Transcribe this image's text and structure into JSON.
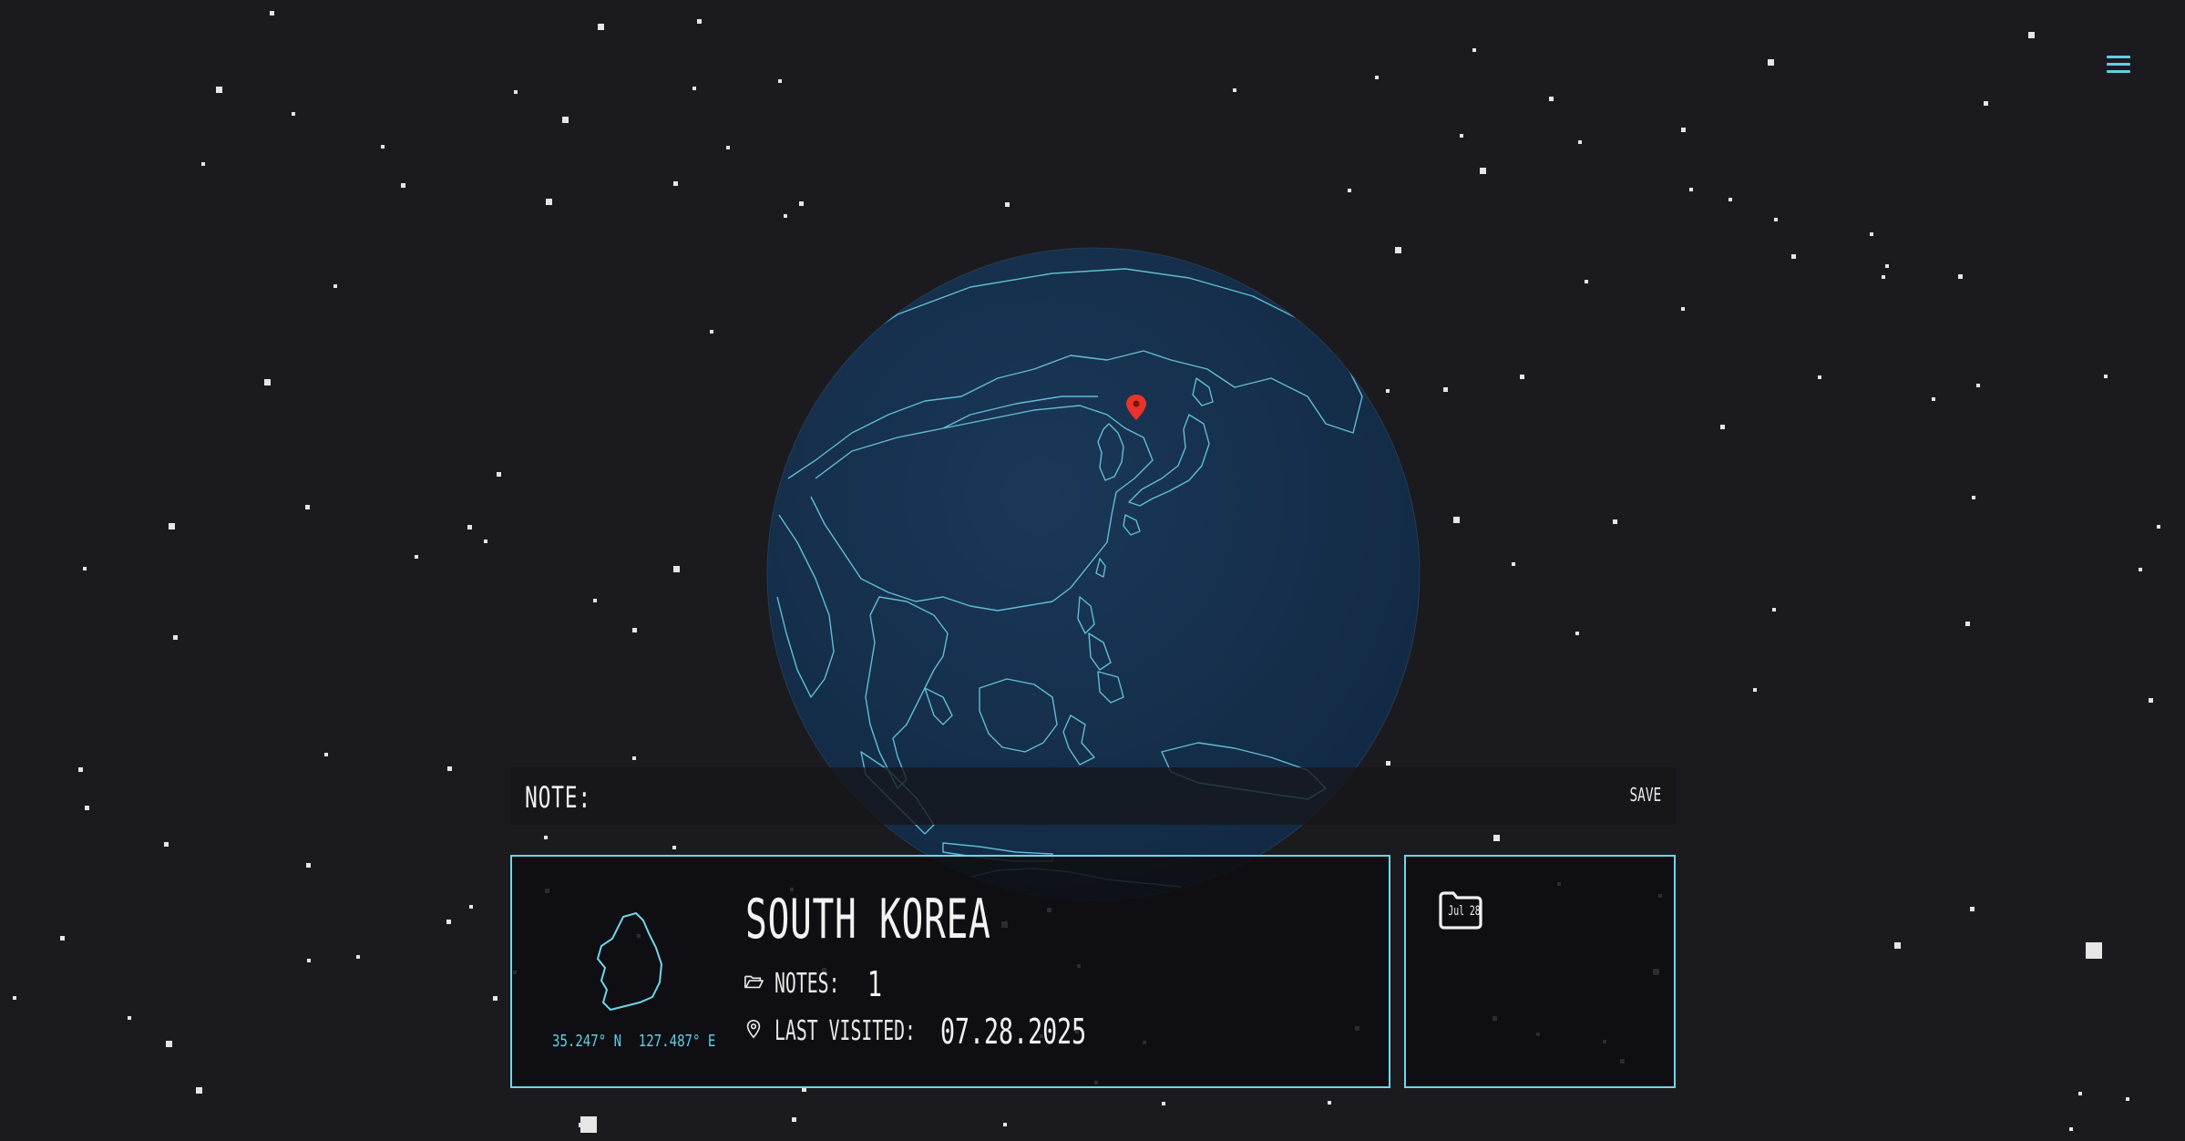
{
  "menu": {
    "icon": "hamburger-menu-icon"
  },
  "globe": {
    "ocean_color": "#173150",
    "outline_color": "#6fd6ea",
    "marker_color": "#e8342c",
    "marker_icon": "location-pin-icon"
  },
  "note_bar": {
    "label": "NOTE:",
    "placeholder": "",
    "save_label": "SAVE"
  },
  "country_card": {
    "name": "SOUTH KOREA",
    "shape_icon": "south-korea-outline-icon",
    "latitude": "35.247° N",
    "longitude": "127.487° E",
    "notes_label": "NOTES:",
    "notes_icon": "open-folder-icon",
    "notes_count": "1",
    "last_visited_label": "LAST VISITED:",
    "last_visited_icon": "map-pin-icon",
    "last_visited": "07.28.2025"
  },
  "notes_panel": {
    "items": [
      {
        "icon": "folder-icon",
        "date_label": "Jul 28"
      }
    ]
  },
  "colors": {
    "background": "#1b1b1f",
    "accent": "#6fd6ea",
    "text": "#e8e8e8"
  }
}
